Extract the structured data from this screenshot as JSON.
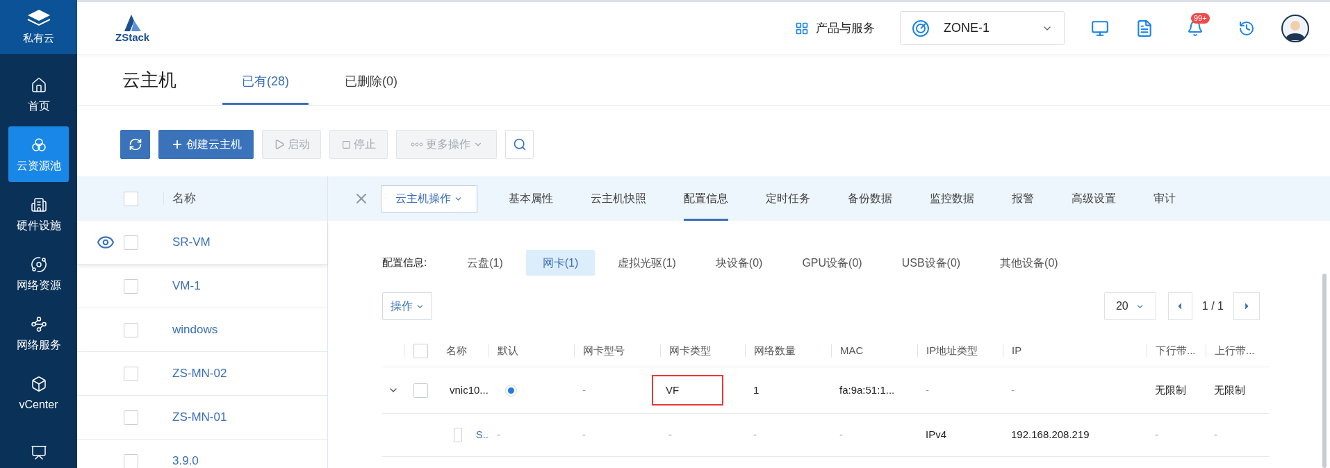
{
  "sidebar": {
    "brand": "私有云",
    "items": [
      {
        "label": "首页",
        "selected": false
      },
      {
        "label": "云资源池",
        "selected": true
      },
      {
        "label": "硬件设施",
        "selected": false
      },
      {
        "label": "网络资源",
        "selected": false
      },
      {
        "label": "网络服务",
        "selected": false
      },
      {
        "label": "vCenter",
        "selected": false
      },
      {
        "selected": false
      }
    ]
  },
  "header": {
    "logo": "ZStack",
    "products": "产品与服务",
    "zone": "ZONE-1",
    "notification_badge": "99+"
  },
  "page": {
    "title": "云主机",
    "tabs": [
      {
        "label": "已有(28)",
        "selected": true
      },
      {
        "label": "已删除(0)",
        "selected": false
      }
    ]
  },
  "toolbar": [
    {
      "kind": "refresh",
      "disabled": false
    },
    {
      "kind": "add",
      "label": "创建云主机",
      "disabled": false
    },
    {
      "kind": "play",
      "label": "启动",
      "disabled": true
    },
    {
      "kind": "stop",
      "label": "停止",
      "disabled": true
    },
    {
      "kind": "more",
      "label": "更多操作",
      "disabled": true
    },
    {
      "kind": "search",
      "disabled": false
    }
  ],
  "vm_list": {
    "header": "名称",
    "select_all_checked": false,
    "rows": [
      {
        "name": "SR-VM",
        "selected": true,
        "checked": false
      },
      {
        "name": "VM-1",
        "selected": false,
        "checked": false
      },
      {
        "name": "windows",
        "selected": false,
        "checked": false
      },
      {
        "name": "ZS-MN-02",
        "selected": false,
        "checked": false
      },
      {
        "name": "ZS-MN-01",
        "selected": false,
        "checked": false
      },
      {
        "name": "3.9.0",
        "selected": false,
        "checked": false
      }
    ]
  },
  "detail": {
    "action_menu": "云主机操作",
    "tabs": [
      {
        "label": "基本属性",
        "selected": false
      },
      {
        "label": "云主机快照",
        "selected": false
      },
      {
        "label": "配置信息",
        "selected": true
      },
      {
        "label": "定时任务",
        "selected": false
      },
      {
        "label": "备份数据",
        "selected": false
      },
      {
        "label": "监控数据",
        "selected": false
      },
      {
        "label": "报警",
        "selected": false
      },
      {
        "label": "高级设置",
        "selected": false
      },
      {
        "label": "审计",
        "selected": false
      }
    ],
    "section_label": "配置信息:",
    "sub_tabs": [
      {
        "label": "云盘(1)",
        "selected": false
      },
      {
        "label": "网卡(1)",
        "selected": true
      },
      {
        "label": "虚拟光驱(1)",
        "selected": false
      },
      {
        "label": "块设备(0)",
        "selected": false
      },
      {
        "label": "GPU设备(0)",
        "selected": false
      },
      {
        "label": "USB设备(0)",
        "selected": false
      },
      {
        "label": "其他设备(0)",
        "selected": false
      }
    ],
    "operation_menu": "操作",
    "page_size": "20",
    "page_indicator": "1 / 1",
    "table": {
      "select_all_checked": false,
      "columns": [
        "名称",
        "默认",
        "网卡型号",
        "网卡类型",
        "网络数量",
        "MAC",
        "IP地址类型",
        "IP",
        "下行带...",
        "上行带..."
      ],
      "rows": [
        {
          "kind": "nic",
          "expanded": true,
          "checked": false,
          "default": true,
          "nic_type_highlighted": true,
          "cells": [
            "vnic10...",
            "",
            "-",
            "VF",
            "1",
            "fa:9a:51:1...",
            "-",
            "-",
            "无限制",
            "无限制"
          ]
        },
        {
          "kind": "ip",
          "checked": false,
          "cells": [
            "S..",
            "-",
            "-",
            "-",
            "-",
            "-",
            "IPv4",
            "192.168.208.219",
            "-",
            "-"
          ]
        }
      ]
    }
  }
}
